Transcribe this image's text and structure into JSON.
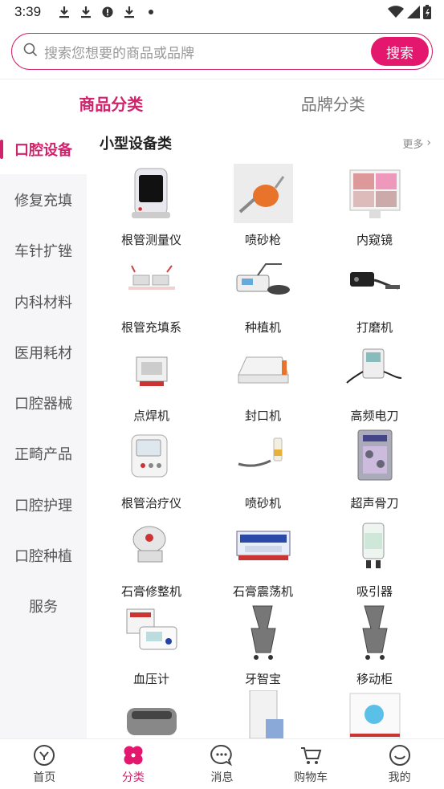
{
  "status_bar": {
    "time": "3:39",
    "icons": [
      "download-icon",
      "download-icon",
      "alert-icon",
      "download-icon",
      "dot-icon"
    ],
    "right_icons": [
      "wifi-icon",
      "signal-icon",
      "battery-icon"
    ]
  },
  "search": {
    "placeholder": "搜索您想要的商品或品牌",
    "button_label": "搜索"
  },
  "tabs": [
    {
      "label": "商品分类",
      "active": true
    },
    {
      "label": "品牌分类",
      "active": false
    }
  ],
  "sidebar": {
    "items": [
      {
        "label": "口腔设备",
        "active": true
      },
      {
        "label": "修复充填"
      },
      {
        "label": "车针扩锉"
      },
      {
        "label": "内科材料"
      },
      {
        "label": "医用耗材"
      },
      {
        "label": "口腔器械"
      },
      {
        "label": "正畸产品"
      },
      {
        "label": "口腔护理"
      },
      {
        "label": "口腔种植"
      },
      {
        "label": "服务"
      }
    ]
  },
  "section": {
    "title": "小型设备类",
    "more_label": "更多"
  },
  "products": [
    {
      "label": "根管测量仪"
    },
    {
      "label": "喷砂枪"
    },
    {
      "label": "内窥镜"
    },
    {
      "label": "根管充填系"
    },
    {
      "label": "种植机"
    },
    {
      "label": "打磨机"
    },
    {
      "label": "点焊机"
    },
    {
      "label": "封口机"
    },
    {
      "label": "高频电刀"
    },
    {
      "label": "根管治疗仪"
    },
    {
      "label": "喷砂机"
    },
    {
      "label": "超声骨刀"
    },
    {
      "label": "石膏修整机"
    },
    {
      "label": "石膏震荡机"
    },
    {
      "label": "吸引器"
    },
    {
      "label": "血压计"
    },
    {
      "label": "牙智宝"
    },
    {
      "label": "移动柜"
    },
    {
      "label": ""
    },
    {
      "label": ""
    },
    {
      "label": ""
    }
  ],
  "bottom_nav": [
    {
      "label": "首页",
      "icon": "home-icon"
    },
    {
      "label": "分类",
      "icon": "category-icon",
      "active": true
    },
    {
      "label": "消息",
      "icon": "message-icon"
    },
    {
      "label": "购物车",
      "icon": "cart-icon"
    },
    {
      "label": "我的",
      "icon": "profile-icon"
    }
  ],
  "colors": {
    "accent": "#d3226c"
  }
}
